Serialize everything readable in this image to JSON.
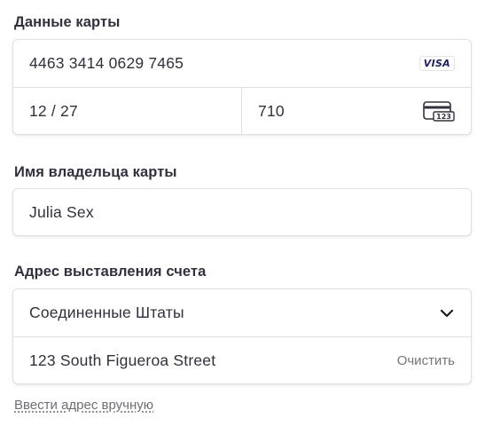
{
  "card": {
    "section_label": "Данные карты",
    "number": "4463 3414 0629 7465",
    "brand": "VISA",
    "expiry": "12 / 27",
    "cvc": "710",
    "cvc_icon_text": "123"
  },
  "cardholder": {
    "section_label": "Имя владельца карты",
    "name": "Julia Sex"
  },
  "billing": {
    "section_label": "Адрес выставления счета",
    "country": "Соединенные Штаты",
    "address_line": "123 South Figueroa Street",
    "clear_label": "Очистить",
    "manual_entry_link": "Ввести адрес вручную"
  },
  "colors": {
    "text": "#30313d",
    "border": "#e0e0e0",
    "muted": "#73757f",
    "visa": "#1a1f71"
  }
}
